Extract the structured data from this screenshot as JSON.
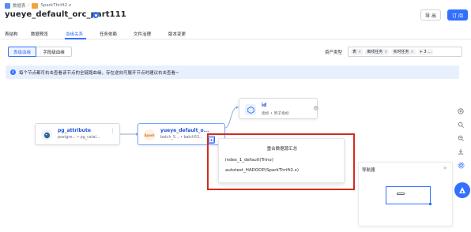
{
  "breadcrumb": {
    "items": [
      "数据表",
      "SparkThrift2.x"
    ],
    "separator": "/"
  },
  "page": {
    "title": "yueye_default_orc_part111"
  },
  "actions": {
    "export_label": "导 出",
    "edit_label": "订 阅"
  },
  "tabs": [
    {
      "label": "表结构",
      "active": false
    },
    {
      "label": "数据预览",
      "active": false
    },
    {
      "label": "血缘关系",
      "active": true
    },
    {
      "label": "任务依赖",
      "active": false
    },
    {
      "label": "文件治理",
      "active": false
    },
    {
      "label": "版本变更",
      "active": false
    }
  ],
  "lineage_mode": {
    "table_label": "表级血缘",
    "field_label": "字段级血缘",
    "selected": "表级血缘"
  },
  "asset_filter": {
    "label": "资产类型",
    "chips": [
      "表",
      "离线任务",
      "实时任务"
    ],
    "more": "+ 3 ..."
  },
  "notice": {
    "icon": "info-icon",
    "text": "每个节点都可右击查看该节点的全链路血缘，存在逆向可展开节点时建议右击查看~"
  },
  "nodes": {
    "pg": {
      "title": "pg_attribute",
      "subtitle": "postgre... • pg_catal..."
    },
    "current": {
      "title": "yueye_default_o...",
      "subtitle": "batch_5... • batch53...",
      "icon_text": "Spark"
    },
    "metric": {
      "title": "id",
      "subtitle": "指标 • 原子指标"
    }
  },
  "popup": {
    "title": "重合数据源汇总",
    "items": [
      "index_1_default(Trino)",
      "autotest_HADOOP(SparkThrift2.x)"
    ]
  },
  "navigator": {
    "title": "导航器",
    "expand_icon": "double-chevron-right-icon"
  },
  "colors": {
    "accent": "#3370ff",
    "highlight": "#d52b1e",
    "notice_bg": "#e8f0fd"
  }
}
